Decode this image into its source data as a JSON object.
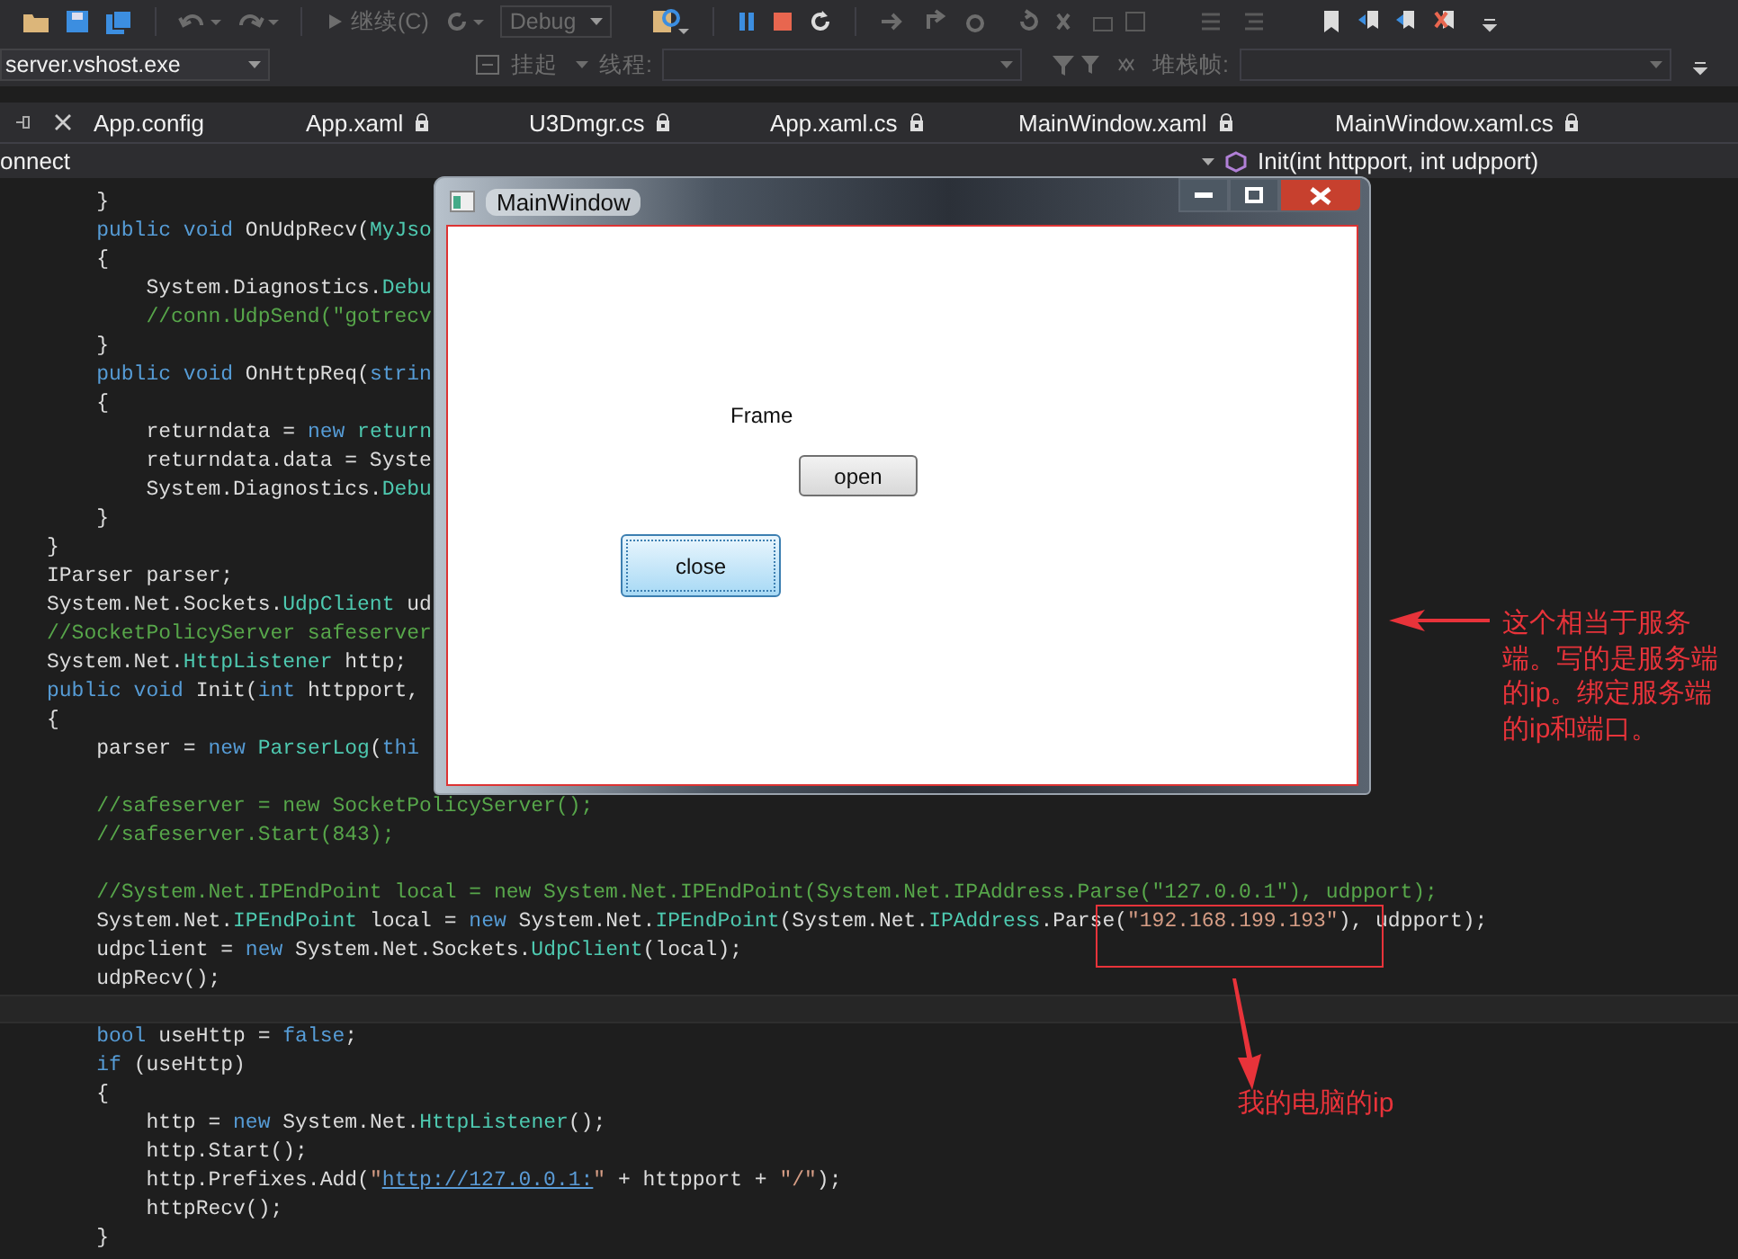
{
  "toolbar": {
    "continue_button": {
      "label": "继续(C)",
      "disabled": true
    },
    "config_combo": {
      "value": "Debug",
      "disabled": true
    }
  },
  "debug_bar": {
    "process": "server.vshost.exe",
    "suspend": "挂起",
    "thread_label": "线程:",
    "stack_label": "堆栈帧:"
  },
  "tabs": [
    {
      "label": "App.config",
      "locked": false
    },
    {
      "label": "App.xaml",
      "locked": true
    },
    {
      "label": "U3Dmgr.cs",
      "locked": true
    },
    {
      "label": "App.xaml.cs",
      "locked": true
    },
    {
      "label": "MainWindow.xaml",
      "locked": true
    },
    {
      "label": "MainWindow.xaml.cs",
      "locked": true
    }
  ],
  "nav_bar": {
    "scope": "onnect",
    "member": "Init(int httpport, int udpport)"
  },
  "code_lines": [
    {
      "current": false,
      "tokens": [
        {
          "kind": "plain",
          "text": "    }"
        }
      ]
    },
    {
      "current": false,
      "tokens": [
        {
          "kind": "keyword",
          "text": "    public void"
        },
        {
          "kind": "plain",
          "text": " OnUdpRecv("
        },
        {
          "kind": "type",
          "text": "MyJso"
        }
      ]
    },
    {
      "current": false,
      "tokens": [
        {
          "kind": "plain",
          "text": "    {"
        }
      ]
    },
    {
      "current": false,
      "tokens": [
        {
          "kind": "plain",
          "text": "        System.Diagnostics."
        },
        {
          "kind": "type",
          "text": "Debu"
        }
      ]
    },
    {
      "current": false,
      "tokens": [
        {
          "kind": "comment",
          "text": "        //conn.UdpSend(\"gotrecv"
        }
      ]
    },
    {
      "current": false,
      "tokens": [
        {
          "kind": "plain",
          "text": "    }"
        }
      ]
    },
    {
      "current": false,
      "tokens": [
        {
          "kind": "keyword",
          "text": "    public void"
        },
        {
          "kind": "plain",
          "text": " OnHttpReq("
        },
        {
          "kind": "keyword",
          "text": "strin"
        }
      ]
    },
    {
      "current": false,
      "tokens": [
        {
          "kind": "plain",
          "text": "    {"
        }
      ]
    },
    {
      "current": false,
      "tokens": [
        {
          "kind": "plain",
          "text": "        returndata = "
        },
        {
          "kind": "keyword",
          "text": "new"
        },
        {
          "kind": "type",
          "text": " return"
        }
      ]
    },
    {
      "current": false,
      "tokens": [
        {
          "kind": "plain",
          "text": "        returndata.data = Syste"
        }
      ]
    },
    {
      "current": false,
      "tokens": [
        {
          "kind": "plain",
          "text": "        System.Diagnostics."
        },
        {
          "kind": "type",
          "text": "Debu"
        }
      ]
    },
    {
      "current": false,
      "tokens": [
        {
          "kind": "plain",
          "text": "    }"
        }
      ]
    },
    {
      "current": false,
      "tokens": [
        {
          "kind": "plain",
          "text": "}"
        }
      ]
    },
    {
      "current": false,
      "tokens": [
        {
          "kind": "plain",
          "text": "IParser parser;"
        }
      ]
    },
    {
      "current": false,
      "tokens": [
        {
          "kind": "plain",
          "text": "System.Net.Sockets."
        },
        {
          "kind": "type",
          "text": "UdpClient"
        },
        {
          "kind": "plain",
          "text": " ud"
        }
      ]
    },
    {
      "current": false,
      "tokens": [
        {
          "kind": "comment",
          "text": "//SocketPolicyServer safeserver"
        }
      ]
    },
    {
      "current": false,
      "tokens": [
        {
          "kind": "plain",
          "text": "System.Net."
        },
        {
          "kind": "type",
          "text": "HttpListener"
        },
        {
          "kind": "plain",
          "text": " http;"
        }
      ]
    },
    {
      "current": false,
      "tokens": [
        {
          "kind": "keyword",
          "text": "public void"
        },
        {
          "kind": "plain",
          "text": " Init("
        },
        {
          "kind": "keyword",
          "text": "int"
        },
        {
          "kind": "plain",
          "text": " httpport,"
        }
      ]
    },
    {
      "current": false,
      "tokens": [
        {
          "kind": "plain",
          "text": "{"
        }
      ]
    },
    {
      "current": false,
      "tokens": [
        {
          "kind": "plain",
          "text": "    parser = "
        },
        {
          "kind": "keyword",
          "text": "new"
        },
        {
          "kind": "type",
          "text": " ParserLog"
        },
        {
          "kind": "plain",
          "text": "("
        },
        {
          "kind": "keyword",
          "text": "thi"
        }
      ]
    },
    {
      "current": false
    },
    {
      "current": false,
      "tokens": [
        {
          "kind": "comment",
          "text": "    //safeserver = new SocketPolicyServer();"
        }
      ]
    },
    {
      "current": false,
      "tokens": [
        {
          "kind": "comment",
          "text": "    //safeserver.Start(843);"
        }
      ]
    },
    {
      "current": false
    },
    {
      "current": false,
      "tokens": [
        {
          "kind": "comment",
          "text": "    //System.Net.IPEndPoint local = new System.Net.IPEndPoint(System.Net.IPAddress.Parse(\"127.0.0.1\"), udpport);"
        }
      ]
    },
    {
      "current": false,
      "tokens": [
        {
          "kind": "plain",
          "text": "    System.Net."
        },
        {
          "kind": "type",
          "text": "IPEndPoint"
        },
        {
          "kind": "plain",
          "text": " local = "
        },
        {
          "kind": "keyword",
          "text": "new"
        },
        {
          "kind": "plain",
          "text": " System.Net."
        },
        {
          "kind": "type",
          "text": "IPEndPoint"
        },
        {
          "kind": "plain",
          "text": "(System.Net."
        },
        {
          "kind": "type",
          "text": "IPAddress"
        },
        {
          "kind": "plain",
          "text": ".Parse("
        },
        {
          "kind": "string",
          "text": "\"192.168.199.193\""
        },
        {
          "kind": "plain",
          "text": "), udpport);"
        }
      ]
    },
    {
      "current": false,
      "tokens": [
        {
          "kind": "plain",
          "text": "    udpclient = "
        },
        {
          "kind": "keyword",
          "text": "new"
        },
        {
          "kind": "plain",
          "text": " System.Net.Sockets."
        },
        {
          "kind": "type",
          "text": "UdpClient"
        },
        {
          "kind": "plain",
          "text": "(local);"
        }
      ]
    },
    {
      "current": false,
      "tokens": [
        {
          "kind": "plain",
          "text": "    udpRecv();"
        }
      ]
    },
    {
      "current": true
    },
    {
      "current": false,
      "tokens": [
        {
          "kind": "keyword",
          "text": "    bool"
        },
        {
          "kind": "plain",
          "text": " useHttp = "
        },
        {
          "kind": "keyword",
          "text": "false"
        },
        {
          "kind": "plain",
          "text": ";"
        }
      ]
    },
    {
      "current": false,
      "tokens": [
        {
          "kind": "keyword",
          "text": "    if"
        },
        {
          "kind": "plain",
          "text": " (useHttp)"
        }
      ]
    },
    {
      "current": false,
      "tokens": [
        {
          "kind": "plain",
          "text": "    {"
        }
      ]
    },
    {
      "current": false,
      "tokens": [
        {
          "kind": "plain",
          "text": "        http = "
        },
        {
          "kind": "keyword",
          "text": "new"
        },
        {
          "kind": "plain",
          "text": " System.Net."
        },
        {
          "kind": "type",
          "text": "HttpListener"
        },
        {
          "kind": "plain",
          "text": "();"
        }
      ]
    },
    {
      "current": false,
      "tokens": [
        {
          "kind": "plain",
          "text": "        http.Start();"
        }
      ]
    },
    {
      "current": false,
      "tokens": [
        {
          "kind": "plain",
          "text": "        http.Prefixes.Add("
        },
        {
          "kind": "string",
          "text": "\""
        },
        {
          "kind": "link",
          "text": "http://127.0.0.1:"
        },
        {
          "kind": "string",
          "text": "\""
        },
        {
          "kind": "plain",
          "text": " + httpport + "
        },
        {
          "kind": "string",
          "text": "\"/\""
        },
        {
          "kind": "plain",
          "text": ");"
        }
      ]
    },
    {
      "current": false,
      "tokens": [
        {
          "kind": "plain",
          "text": "        httpRecv();"
        }
      ]
    },
    {
      "current": false,
      "tokens": [
        {
          "kind": "plain",
          "text": "    }"
        }
      ]
    }
  ],
  "window": {
    "title": "MainWindow",
    "frame_label": "Frame",
    "buttons": [
      {
        "label": "open",
        "focused": false
      },
      {
        "label": "close",
        "focused": true
      }
    ]
  },
  "annotations": {
    "server_note": "这个相当于服务端。写的是服务端的ip。绑定服务端的ip和端口。",
    "ip_note": "我的电脑的ip"
  }
}
